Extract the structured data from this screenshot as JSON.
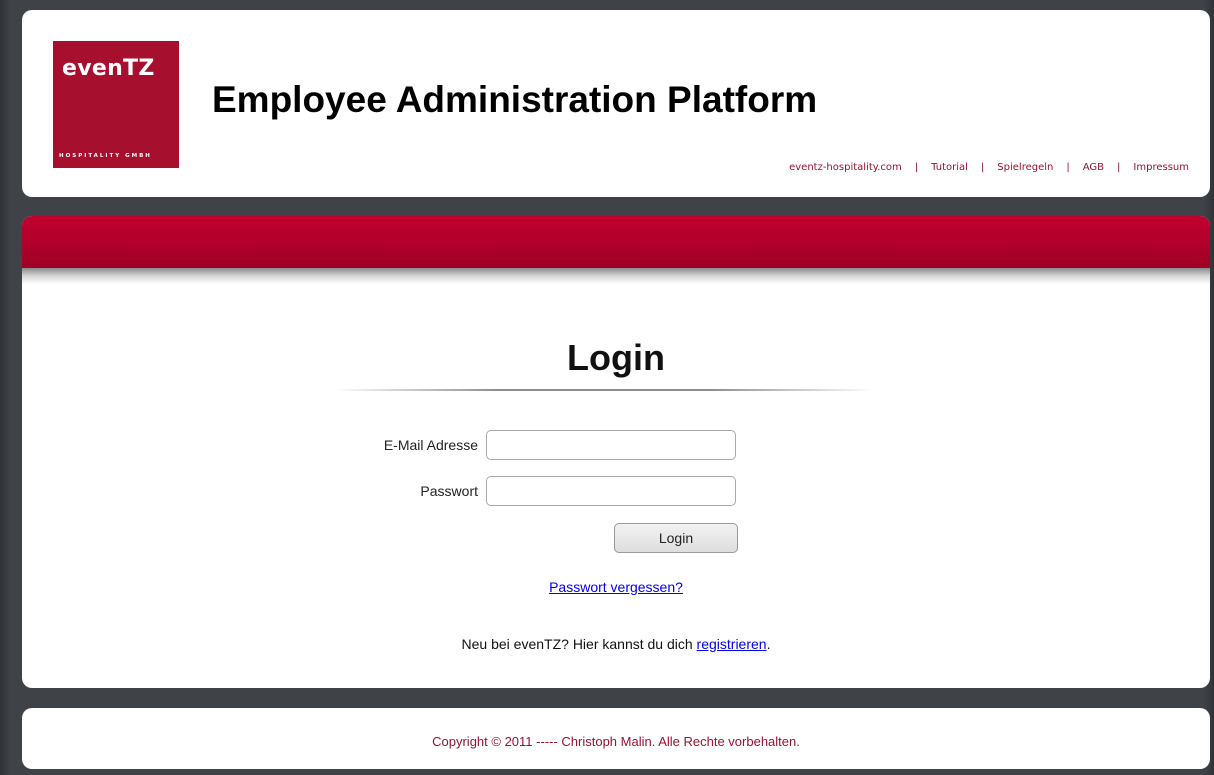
{
  "header": {
    "logo_text": "evenTZ",
    "logo_subtext": "HOSPITALITY GMBH",
    "title": "Employee Administration Platform",
    "links": [
      {
        "label": "eventz-hospitality.com"
      },
      {
        "label": "Tutorial"
      },
      {
        "label": "Spielregeln"
      },
      {
        "label": "AGB"
      },
      {
        "label": "Impressum"
      }
    ],
    "separator": "|"
  },
  "login": {
    "heading": "Login",
    "email_label": "E-Mail Adresse",
    "email_value": "",
    "password_label": "Passwort",
    "password_value": "",
    "button_label": "Login",
    "forgot_link": "Passwort vergessen?",
    "register_prefix": "Neu bei evenTZ? Hier kannst du dich ",
    "register_link": "registrieren",
    "register_suffix": "."
  },
  "footer": {
    "copyright": "Copyright © 2011 ----- Christoph Malin. Alle Rechte vorbehalten."
  },
  "colors": {
    "brand_red": "#a60f2d",
    "band_red": "#b2002c",
    "link_red": "#9a1132",
    "page_bg": "#3b3f43",
    "link_blue": "#0000ee"
  }
}
